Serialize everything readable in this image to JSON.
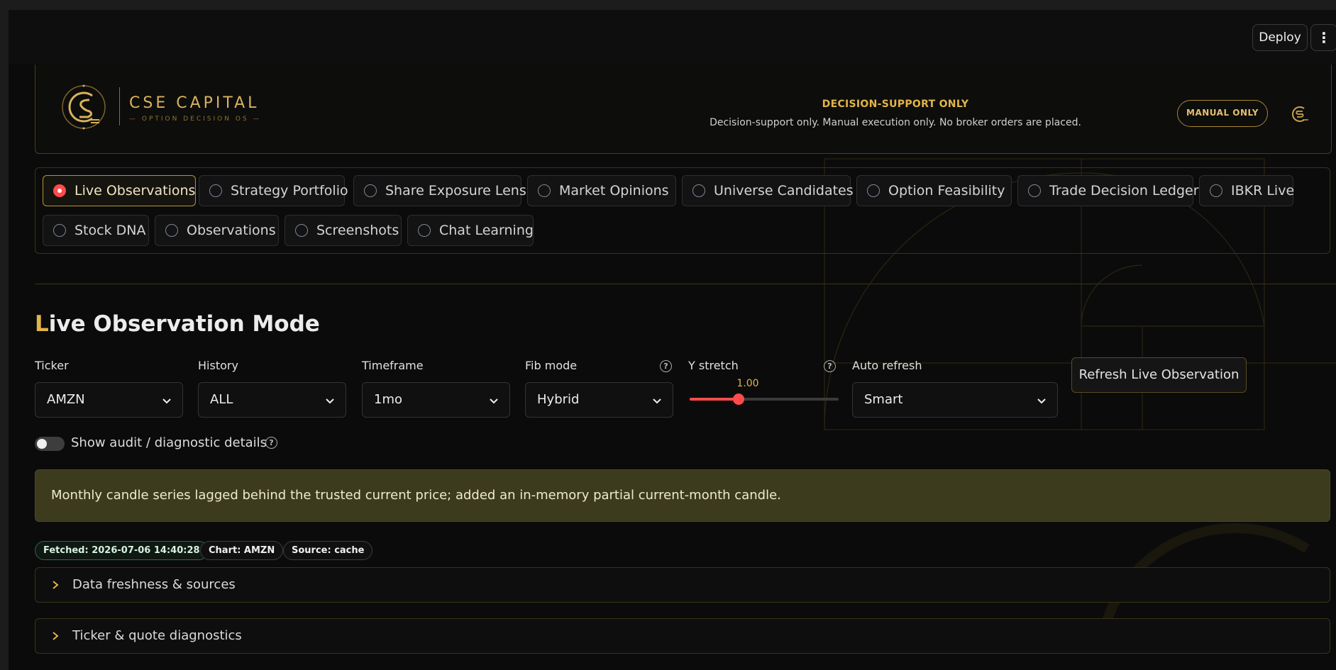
{
  "topbar": {
    "deploy_label": "Deploy",
    "menu_icon": "⋮"
  },
  "brand": {
    "name": "CSE CAPITAL",
    "subtitle": "OPTION DECISION OS"
  },
  "notice": {
    "title": "DECISION-SUPPORT ONLY",
    "text": "Decision-support only. Manual execution only. No broker orders are placed."
  },
  "badge": {
    "label": "MANUAL ONLY"
  },
  "colors": {
    "accent": "#e1b547",
    "active": "#ff4b4b",
    "alert_bg": "#3d3b1d"
  },
  "tabs": [
    {
      "label": "Live Observations",
      "selected": true
    },
    {
      "label": "Strategy Portfolio",
      "selected": false
    },
    {
      "label": "Share Exposure Lens",
      "selected": false
    },
    {
      "label": "Market Opinions",
      "selected": false
    },
    {
      "label": "Universe Candidates",
      "selected": false
    },
    {
      "label": "Option Feasibility",
      "selected": false
    },
    {
      "label": "Trade Decision Ledger",
      "selected": false
    },
    {
      "label": "IBKR Live",
      "selected": false
    },
    {
      "label": "Stock DNA",
      "selected": false
    },
    {
      "label": "Observations",
      "selected": false
    },
    {
      "label": "Screenshots",
      "selected": false
    },
    {
      "label": "Chat Learning",
      "selected": false
    }
  ],
  "page": {
    "title_first": "L",
    "title_rest": "ive Observation Mode"
  },
  "controls": {
    "ticker": {
      "label": "Ticker",
      "value": "AMZN"
    },
    "history": {
      "label": "History",
      "value": "ALL"
    },
    "timeframe": {
      "label": "Timeframe",
      "value": "1mo"
    },
    "fib_mode": {
      "label": "Fib mode",
      "value": "Hybrid"
    },
    "y_stretch": {
      "label": "Y stretch",
      "value": "1.00",
      "fraction": 0.33
    },
    "auto_refresh": {
      "label": "Auto refresh",
      "value": "Smart"
    },
    "refresh_label": "Refresh Live Observation"
  },
  "toggle": {
    "label": "Show audit / diagnostic details",
    "on": false
  },
  "alert": {
    "text": "Monthly candle series lagged behind the trusted current price; added an in-memory partial current-month candle."
  },
  "pills": {
    "fetched": "Fetched: 2026-07-06 14:40:28",
    "chart": "Chart: AMZN",
    "source": "Source: cache"
  },
  "expanders": [
    {
      "label": "Data freshness & sources"
    },
    {
      "label": "Ticker & quote diagnostics"
    }
  ]
}
